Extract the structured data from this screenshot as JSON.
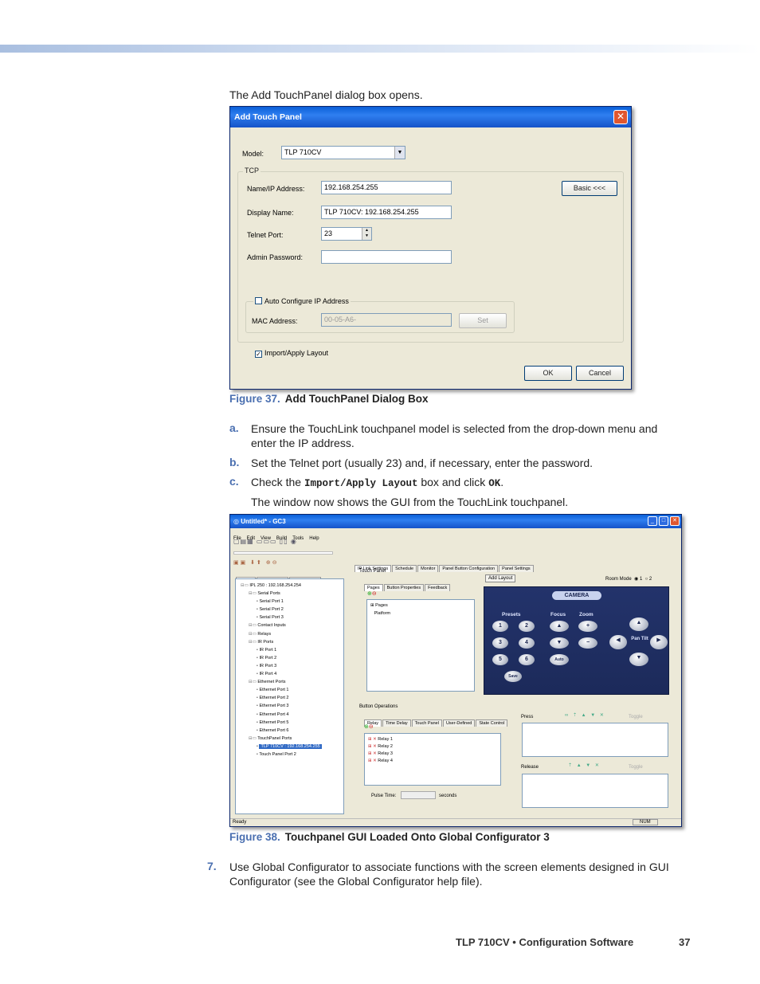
{
  "intro": "The Add TouchPanel dialog box opens.",
  "dialog": {
    "title": "Add Touch Panel",
    "close": "✕",
    "model_label": "Model:",
    "model_value": "TLP 710CV",
    "tcp_label": "TCP",
    "name_label": "Name/IP Address:",
    "name_value": "192.168.254.255",
    "basic_button": "Basic <<<",
    "display_label": "Display Name:",
    "display_value": "TLP 710CV: 192.168.254.255",
    "telnet_label": "Telnet Port:",
    "telnet_value": "23",
    "admin_label": "Admin Password:",
    "auto_label": "Auto Configure IP Address",
    "mac_label": "MAC Address:",
    "mac_value": "00-05-A6-",
    "set_button": "Set",
    "import_label": "Import/Apply Layout",
    "ok": "OK",
    "cancel": "Cancel"
  },
  "figure37": {
    "num": "Figure 37.",
    "title": "Add TouchPanel Dialog Box"
  },
  "steps": [
    {
      "letter": "a.",
      "text": "Ensure the TouchLink touchpanel model is selected from the drop-down menu and enter the IP address."
    },
    {
      "letter": "b.",
      "text": "Set the Telnet port (usually 23) and, if necessary, enter the password."
    }
  ],
  "step_c": {
    "letter": "c.",
    "pre": "Check the ",
    "code1": "Import/Apply Layout",
    "mid": " box and click ",
    "code2": "OK",
    "post": "."
  },
  "window_note": "The window now shows the GUI from the TouchLink touchpanel.",
  "gc3": {
    "title": "Untitled* - GC3",
    "menu": [
      "File",
      "Edit",
      "View",
      "Build",
      "Tools",
      "Help"
    ],
    "left_tabs": [
      "IP Link",
      "Config Guide",
      "GlobalViewer"
    ],
    "tree": [
      "IPL 250 : 192.168.254.254",
      "Serial Ports",
      "Serial Port 1",
      "Serial Port 2",
      "Serial Port 3",
      "Contact Inputs",
      "Relays",
      "IR Ports",
      "IR Port 1",
      "IR Port 2",
      "IR Port 3",
      "IR Port 4",
      "Ethernet Ports",
      "Ethernet Port 1",
      "Ethernet Port 2",
      "Ethernet Port 3",
      "Ethernet Port 4",
      "Ethernet Port 5",
      "Ethernet Port 6",
      "TouchPanel Ports",
      "TLP 710CV : 192.168.254.255",
      "Touch Panel Port 2"
    ],
    "right_tabs": [
      "IP Link Settings",
      "Schedule",
      "Monitor",
      "Panel Button Configuration",
      "Panel Settings"
    ],
    "touch_panel_label": "Touch Panel",
    "sub_tabs": [
      "Pages",
      "Button Properties",
      "Feedback"
    ],
    "pages_tree": [
      "Pages",
      "Platform"
    ],
    "add_layout": "Add Layout",
    "room_mode": "Room Mode",
    "room_1": "1",
    "room_2": "2",
    "camera": {
      "title": "CAMERA",
      "presets": "Presets",
      "focus": "Focus",
      "zoom": "Zoom",
      "auto": "Auto",
      "save": "Save",
      "pan_tilt": "Pan Tilt",
      "numbers": [
        "1",
        "2",
        "3",
        "4",
        "5",
        "6"
      ]
    },
    "button_ops": "Button Operations",
    "ops_tabs": [
      "Relay",
      "Time Delay",
      "Touch Panel",
      "User-Defined",
      "State Control"
    ],
    "relays": [
      "Relay 1",
      "Relay 2",
      "Relay 3",
      "Relay 4"
    ],
    "press": "Press",
    "release": "Release",
    "toggle": "Toggle",
    "pulse_time": "Pulse Time:",
    "seconds": "seconds",
    "status": "Ready",
    "num": "NUM"
  },
  "figure38": {
    "num": "Figure 38.",
    "title": "Touchpanel GUI Loaded Onto Global Configurator 3"
  },
  "step7": {
    "num": "7.",
    "text": "Use Global Configurator to associate functions with the screen elements designed in GUI Configurator (see the Global Configurator help file)."
  },
  "footer": {
    "title": "TLP 710CV • Configuration Software",
    "page": "37"
  }
}
